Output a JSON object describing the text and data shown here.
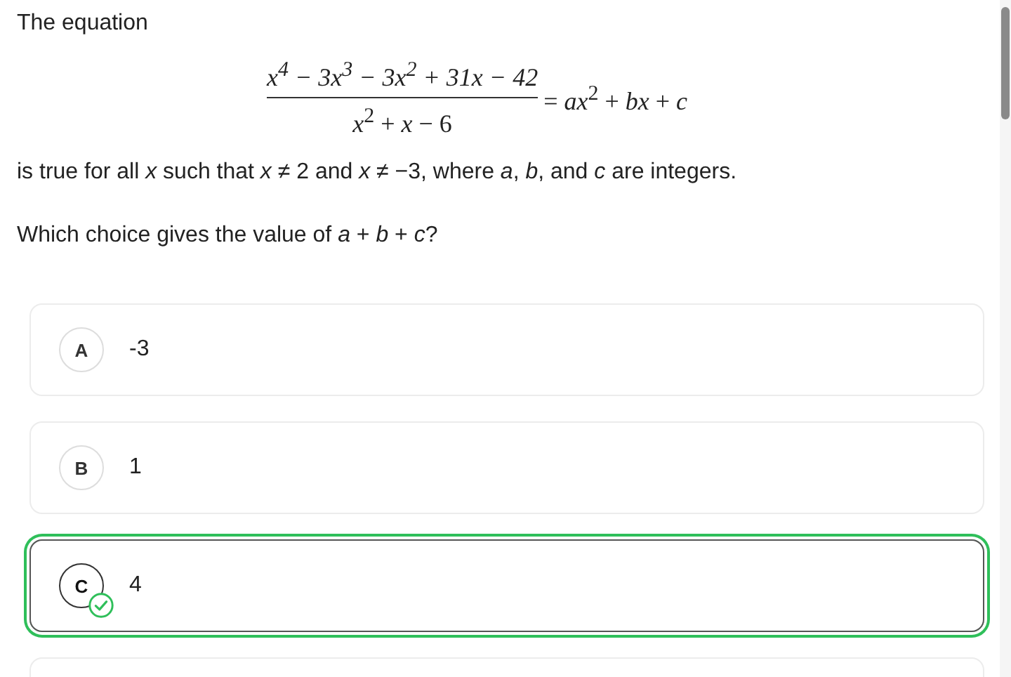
{
  "question": {
    "intro": "The equation",
    "numerator": "x$^{4}$ − 3x$^{3}$ − 3x$^{2}$ + 31x − 42",
    "denominator": "*x*$^{2}$ + *x* − 6",
    "rhs": "= *ax*$^{2}$ + *bx* + *c*",
    "condition": "is true for all *x* such that *x* ≠ 2 and *x* ≠ −3, where *a*, *b*, and *c* are integers.",
    "prompt": "Which choice gives the value of *a* + *b* + *c*?"
  },
  "options": [
    {
      "letter": "A",
      "text": "-3",
      "selected": false,
      "correct": false
    },
    {
      "letter": "B",
      "text": "1",
      "selected": false,
      "correct": false
    },
    {
      "letter": "C",
      "text": "4",
      "selected": true,
      "correct": true
    }
  ]
}
